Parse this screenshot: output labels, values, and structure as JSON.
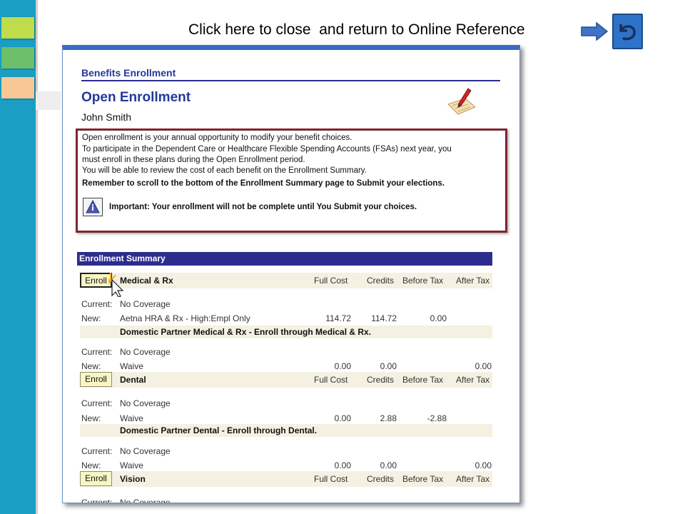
{
  "top_link": {
    "text": "Click here to close  and return to Online Reference"
  },
  "page": {
    "section_title": "Benefits Enrollment",
    "title": "Open Enrollment",
    "employee_name": "John Smith",
    "info_lines": [
      "Open enrollment is your annual opportunity to modify your benefit choices.",
      "To participate in the Dependent Care or Healthcare Flexible Spending Accounts (FSAs) next year, you",
      "must enroll in these plans during the Open Enrollment period.",
      "You will be able to review the cost of each benefit on the Enrollment Summary."
    ],
    "info_bold": "Remember to scroll to the bottom of the Enrollment Summary page to Submit your elections.",
    "important_text": "Important: Your enrollment will not be complete until You Submit your choices."
  },
  "summary": {
    "header": "Enrollment Summary",
    "columns": {
      "full_cost": "Full Cost",
      "credits": "Credits",
      "before_tax": "Before Tax",
      "after_tax": "After Tax"
    },
    "enroll_label": "Enroll",
    "current_label": "Current:",
    "new_label": "New:",
    "plans": [
      {
        "name": "Medical & Rx",
        "current": "No Coverage",
        "new": "Aetna HRA & Rx - High:Empl Only",
        "full_cost": "114.72",
        "credits": "114.72",
        "before_tax": "0.00",
        "after_tax": "",
        "domestic": "Domestic Partner Medical & Rx - Enroll through Medical & Rx.",
        "dp_current": "No Coverage",
        "dp_new": "Waive",
        "dp_full_cost": "0.00",
        "dp_credits": "0.00",
        "dp_before_tax": "",
        "dp_after_tax": "0.00"
      },
      {
        "name": "Dental",
        "current": "No Coverage",
        "new": "Waive",
        "full_cost": "0.00",
        "credits": "2.88",
        "before_tax": "-2.88",
        "after_tax": "",
        "domestic": "Domestic Partner Dental - Enroll through Dental.",
        "dp_current": "No Coverage",
        "dp_new": "Waive",
        "dp_full_cost": "0.00",
        "dp_credits": "0.00",
        "dp_before_tax": "",
        "dp_after_tax": "0.00"
      },
      {
        "name": "Vision",
        "current": "No Coverage"
      }
    ]
  }
}
